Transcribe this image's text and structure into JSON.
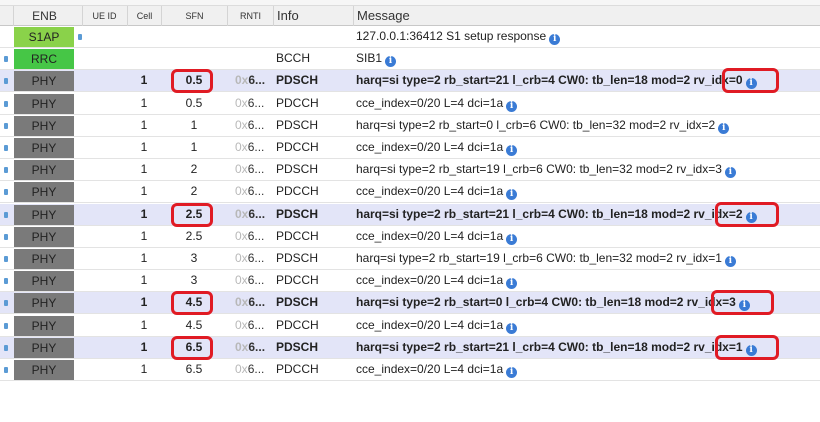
{
  "columns": {
    "enb": "ENB",
    "ue_id": "UE ID",
    "cell": "Cell",
    "sfn": "SFN",
    "rnti": "RNTI",
    "info": "Info",
    "message": "Message"
  },
  "rows": [
    {
      "enb": "S1AP",
      "cell": "",
      "sfn": "",
      "rnti_prefix": "",
      "rnti_tail": "",
      "info": "",
      "message": "127.0.0.1:36412 S1 setup response"
    },
    {
      "enb": "RRC",
      "cell": "",
      "sfn": "",
      "rnti_prefix": "",
      "rnti_tail": "",
      "info": "BCCH",
      "message": "SIB1"
    },
    {
      "enb": "PHY",
      "cell": "1",
      "sfn": "0.5",
      "rnti_prefix": "0x",
      "rnti_tail": "6...",
      "info": "PDSCH",
      "message": "harq=si type=2 rb_start=21 l_crb=4 CW0: tb_len=18 mod=2 rv_idx=0"
    },
    {
      "enb": "PHY",
      "cell": "1",
      "sfn": "0.5",
      "rnti_prefix": "0x",
      "rnti_tail": "6...",
      "info": "PDCCH",
      "message": "cce_index=0/20 L=4 dci=1a"
    },
    {
      "enb": "PHY",
      "cell": "1",
      "sfn": "1",
      "rnti_prefix": "0x",
      "rnti_tail": "6...",
      "info": "PDSCH",
      "message": "harq=si type=2 rb_start=0 l_crb=6 CW0: tb_len=32 mod=2 rv_idx=2"
    },
    {
      "enb": "PHY",
      "cell": "1",
      "sfn": "1",
      "rnti_prefix": "0x",
      "rnti_tail": "6...",
      "info": "PDCCH",
      "message": "cce_index=0/20 L=4 dci=1a"
    },
    {
      "enb": "PHY",
      "cell": "1",
      "sfn": "2",
      "rnti_prefix": "0x",
      "rnti_tail": "6...",
      "info": "PDSCH",
      "message": "harq=si type=2 rb_start=19 l_crb=6 CW0: tb_len=32 mod=2 rv_idx=3"
    },
    {
      "enb": "PHY",
      "cell": "1",
      "sfn": "2",
      "rnti_prefix": "0x",
      "rnti_tail": "6...",
      "info": "PDCCH",
      "message": "cce_index=0/20 L=4 dci=1a"
    },
    {
      "enb": "PHY",
      "cell": "1",
      "sfn": "2.5",
      "rnti_prefix": "0x",
      "rnti_tail": "6...",
      "info": "PDSCH",
      "message": "harq=si type=2 rb_start=21 l_crb=4 CW0: tb_len=18 mod=2 rv_idx=2"
    },
    {
      "enb": "PHY",
      "cell": "1",
      "sfn": "2.5",
      "rnti_prefix": "0x",
      "rnti_tail": "6...",
      "info": "PDCCH",
      "message": "cce_index=0/20 L=4 dci=1a"
    },
    {
      "enb": "PHY",
      "cell": "1",
      "sfn": "3",
      "rnti_prefix": "0x",
      "rnti_tail": "6...",
      "info": "PDSCH",
      "message": "harq=si type=2 rb_start=19 l_crb=6 CW0: tb_len=32 mod=2 rv_idx=1"
    },
    {
      "enb": "PHY",
      "cell": "1",
      "sfn": "3",
      "rnti_prefix": "0x",
      "rnti_tail": "6...",
      "info": "PDCCH",
      "message": "cce_index=0/20 L=4 dci=1a"
    },
    {
      "enb": "PHY",
      "cell": "1",
      "sfn": "4.5",
      "rnti_prefix": "0x",
      "rnti_tail": "6...",
      "info": "PDSCH",
      "message": "harq=si type=2 rb_start=0 l_crb=4 CW0: tb_len=18 mod=2 rv_idx=3"
    },
    {
      "enb": "PHY",
      "cell": "1",
      "sfn": "4.5",
      "rnti_prefix": "0x",
      "rnti_tail": "6...",
      "info": "PDCCH",
      "message": "cce_index=0/20 L=4 dci=1a"
    },
    {
      "enb": "PHY",
      "cell": "1",
      "sfn": "6.5",
      "rnti_prefix": "0x",
      "rnti_tail": "6...",
      "info": "PDSCH",
      "message": "harq=si type=2 rb_start=21 l_crb=4 CW0: tb_len=18 mod=2 rv_idx=1"
    },
    {
      "enb": "PHY",
      "cell": "1",
      "sfn": "6.5",
      "rnti_prefix": "0x",
      "rnti_tail": "6...",
      "info": "PDCCH",
      "message": "cce_index=0/20 L=4 dci=1a"
    }
  ],
  "highlighted_rows": [
    2,
    8,
    12,
    14
  ],
  "colors": {
    "phy": "#7a7a7a",
    "s1ap": "#8ad24a",
    "rrc": "#46c646",
    "highlight_row": "#e3e5f8",
    "annotation_ring": "#e01b24",
    "info_icon": "#3a7bd5"
  },
  "icons": {
    "message_info": "info-circle-icon",
    "row_marker": "row-marker-icon"
  }
}
